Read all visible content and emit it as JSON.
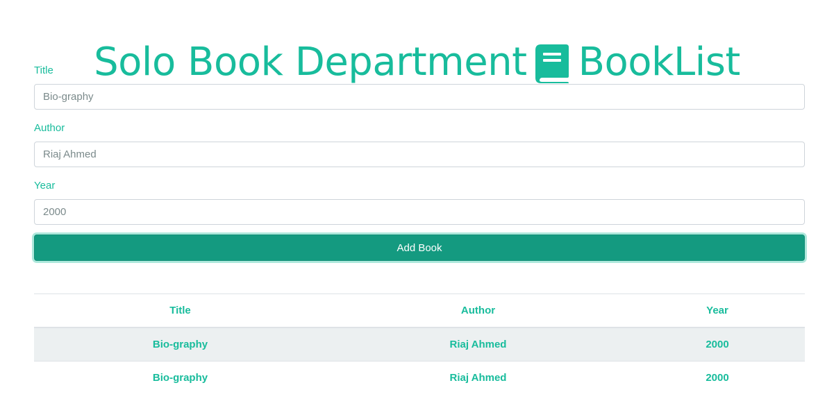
{
  "header": {
    "title_left": "Solo Book Department",
    "title_right": "BookList",
    "icon": "book-icon",
    "accent_color": "#18bc9c"
  },
  "form": {
    "title_label": "Title",
    "title_value": "Bio-graphy",
    "author_label": "Author",
    "author_value": "Riaj Ahmed",
    "year_label": "Year",
    "year_value": "2000",
    "submit_label": "Add Book",
    "submit_color": "#149a80"
  },
  "table": {
    "columns": [
      "Title",
      "Author",
      "Year"
    ],
    "rows": [
      {
        "title": "Bio-graphy",
        "author": "Riaj Ahmed",
        "year": "2000"
      },
      {
        "title": "Bio-graphy",
        "author": "Riaj Ahmed",
        "year": "2000"
      }
    ]
  }
}
